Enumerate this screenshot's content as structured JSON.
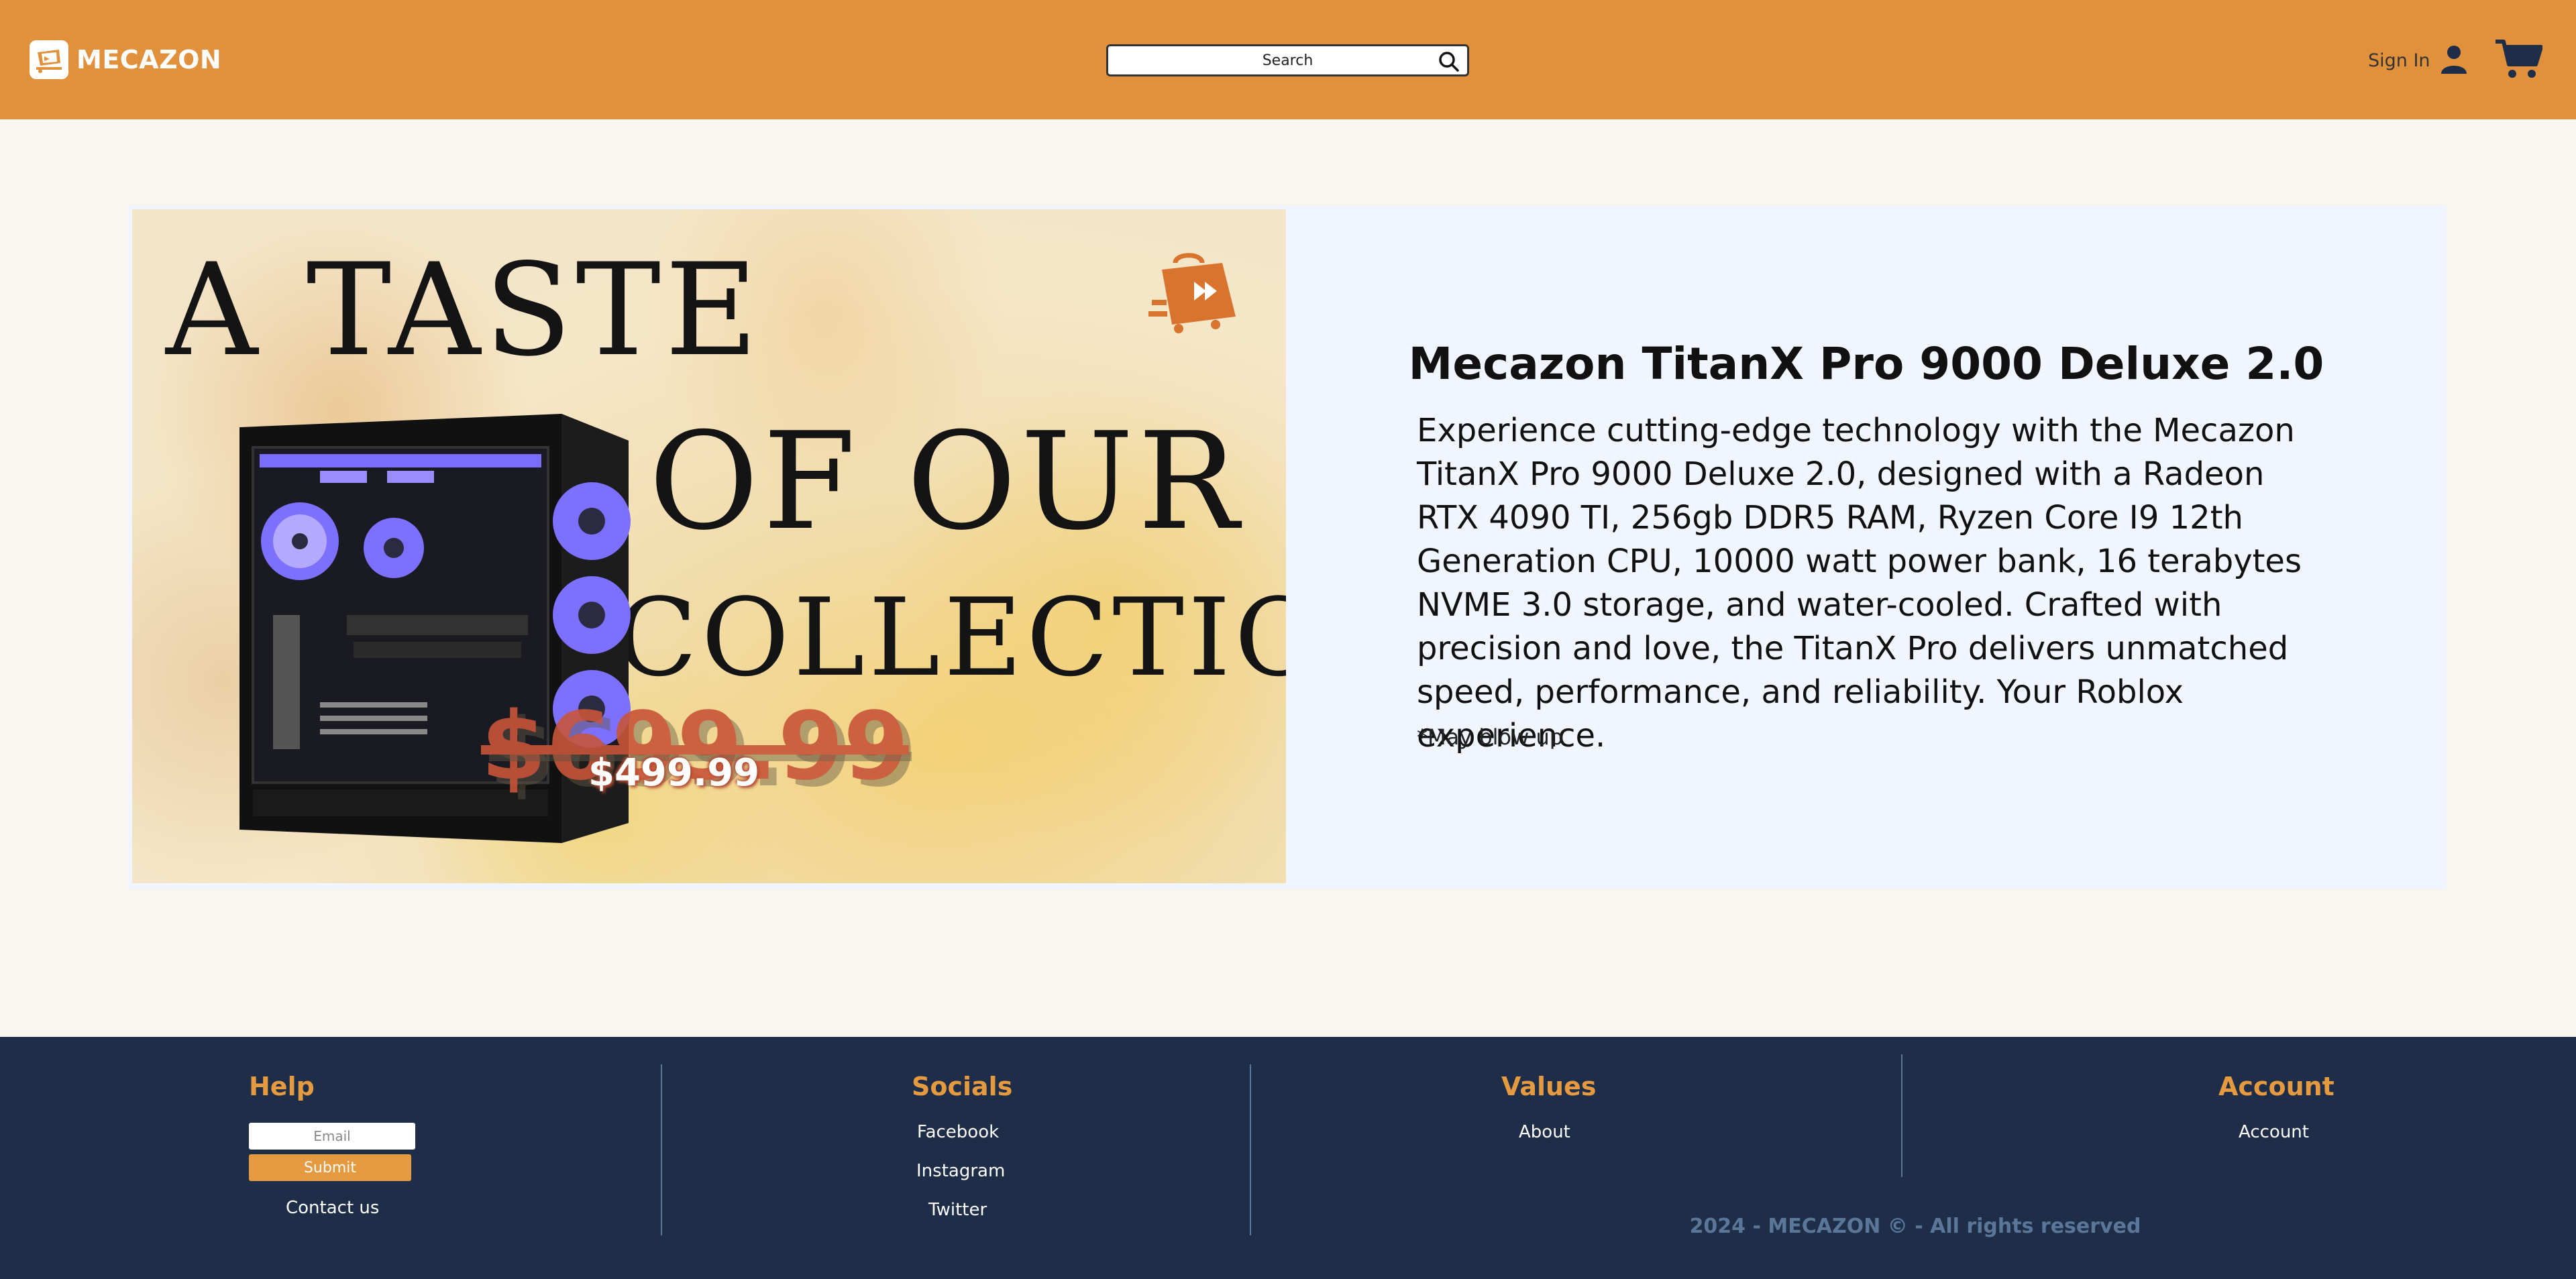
{
  "header": {
    "brand": "MECAZON",
    "search_placeholder": "Search",
    "signin_label": "Sign In"
  },
  "banner": {
    "line1": "A TASTE",
    "line2": "OF OUR",
    "line3": "COLLECTION",
    "old_price": "$699.99",
    "new_price": "$499.99"
  },
  "product": {
    "title": "Mecazon TitanX Pro 9000 Deluxe 2.0",
    "description": "Experience cutting-edge technology with the Mecazon TitanX Pro 9000 Deluxe 2.0, designed with a Radeon RTX 4090 TI, 256gb DDR5 RAM, Ryzen Core I9 12th Generation CPU, 10000 watt power bank, 16 terabytes NVME 3.0 storage, and water-cooled. Crafted with precision and love, the TitanX Pro delivers unmatched speed, performance, and reliability. Your Roblox experience.",
    "note": "*May blow up"
  },
  "footer": {
    "help": {
      "title": "Help",
      "email_placeholder": "Email",
      "submit_label": "Submit",
      "contact_label": "Contact us"
    },
    "socials": {
      "title": "Socials",
      "links": [
        "Facebook",
        "Instagram",
        "Twitter"
      ]
    },
    "values": {
      "title": "Values",
      "links": [
        "About"
      ]
    },
    "account": {
      "title": "Account",
      "links": [
        "Account"
      ]
    },
    "copyright": "2024 - MECAZON © - All rights reserved"
  },
  "colors": {
    "header_bg": "#e1913b",
    "footer_bg": "#1f2e48",
    "accent": "#e69a3f",
    "page_bg": "#faf7f0",
    "card_bg": "#f0f5ff"
  },
  "icons": [
    "logo-icon",
    "search-icon",
    "user-icon",
    "cart-icon",
    "shopping-bag-icon"
  ]
}
